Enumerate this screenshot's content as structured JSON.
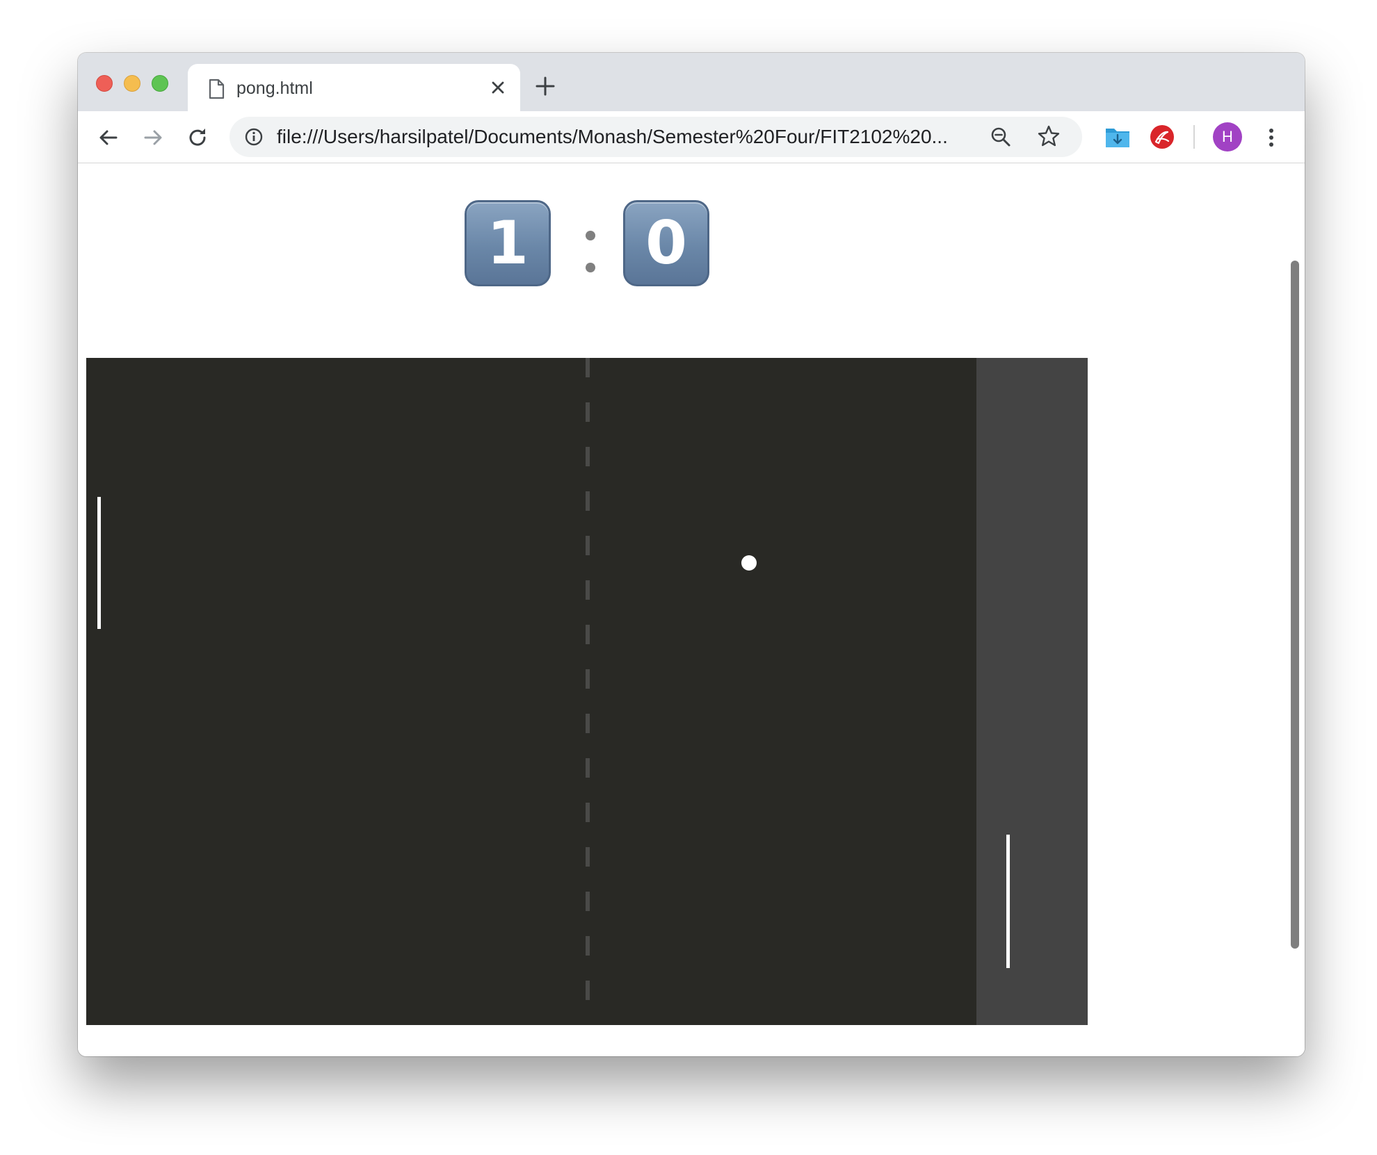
{
  "window": {
    "traffic_lights": [
      "close",
      "minimize",
      "zoom"
    ]
  },
  "tab": {
    "title": "pong.html",
    "icon": "document-icon"
  },
  "toolbar": {
    "url": "file:///Users/harsilpatel/Documents/Monash/Semester%20Four/FIT2102%20...",
    "profile_initial": "H",
    "profile_color": "#a142c4"
  },
  "game": {
    "score_left": "1",
    "score_right": "0",
    "court_color": "#292925",
    "cpu_zone_color": "#444444",
    "net_color": "#4a4a48",
    "paddle_color": "#ffffff",
    "ball_color": "#ffffff"
  }
}
